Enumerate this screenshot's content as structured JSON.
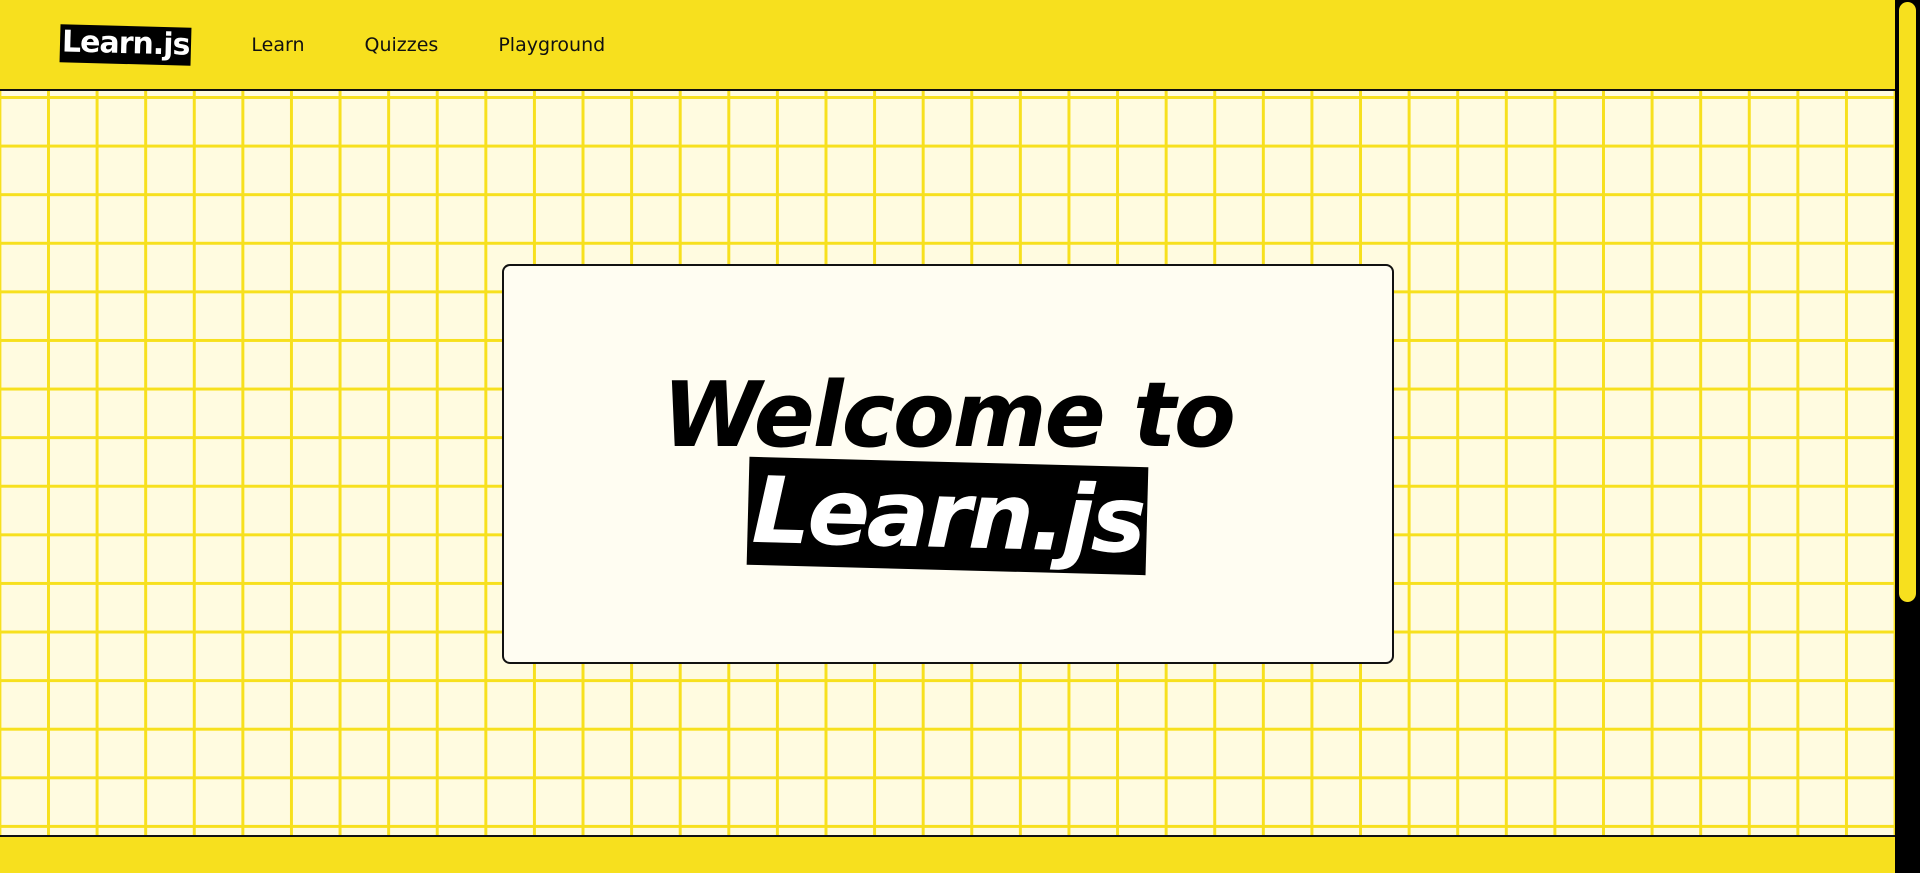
{
  "header": {
    "logo_text": "Learn.js",
    "nav": [
      {
        "label": "Learn"
      },
      {
        "label": "Quizzes"
      },
      {
        "label": "Playground"
      }
    ]
  },
  "hero": {
    "line1": "Welcome to",
    "line2": "Learn.js"
  },
  "colors": {
    "accent": "#f7e01e",
    "background": "#fffbe0",
    "card": "#fffdf2",
    "ink": "#000000"
  }
}
